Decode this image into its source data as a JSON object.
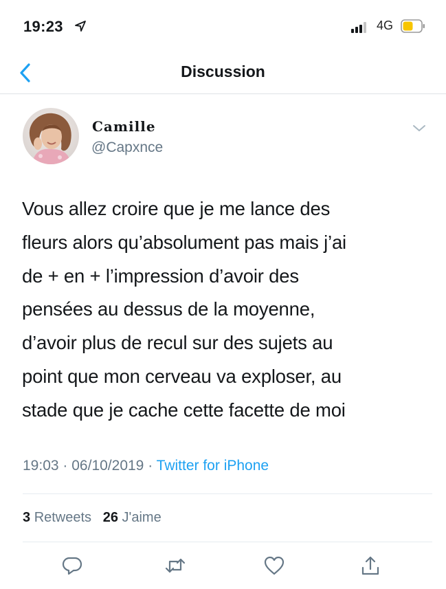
{
  "status_bar": {
    "time": "19:23",
    "network": "4G",
    "icons": [
      "location-arrow-icon",
      "signal-bars-icon",
      "battery-icon"
    ],
    "battery_color": "#f7c500"
  },
  "nav": {
    "back_icon": "chevron-left-icon",
    "title": "Discussion",
    "accent": "#1da1f2"
  },
  "tweet": {
    "display_name": "Camille",
    "handle": "@Capxnce",
    "more_icon": "chevron-down-icon",
    "text_lines": [
      "Vous allez croire que je me lance des",
      "fleurs alors qu’absolument pas mais j’ai",
      "de + en + l’impression d’avoir des",
      "pensées au dessus de la moyenne,",
      "d’avoir plus de recul sur des sujets au",
      "point que mon cerveau va exploser, au",
      "stade que je cache cette facette de moi"
    ],
    "time": "19:03",
    "date": "06/10/2019",
    "separator": "·",
    "source": "Twitter for iPhone",
    "retweets_count": "3",
    "retweets_label": "Retweets",
    "likes_count": "26",
    "likes_label": "J'aime"
  },
  "actions": [
    "reply-icon",
    "retweet-icon",
    "like-icon",
    "share-icon"
  ],
  "colors": {
    "text": "#14171a",
    "secondary": "#657786",
    "link": "#1da1f2",
    "divider": "#e6ecf0"
  }
}
